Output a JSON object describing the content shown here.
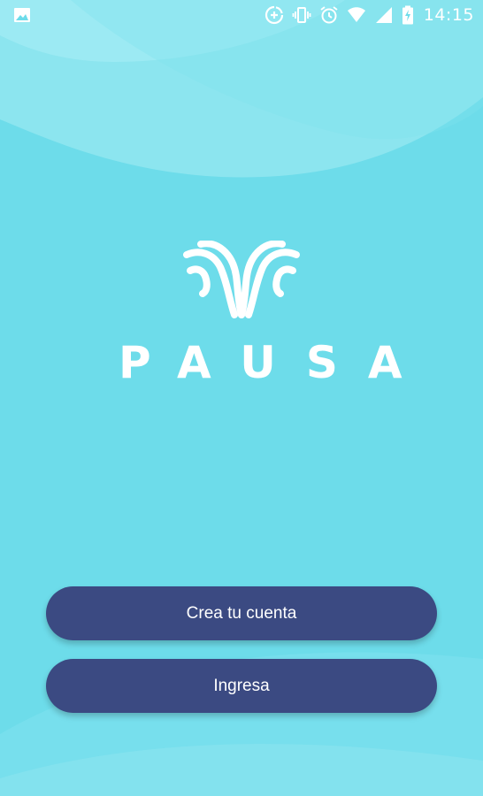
{
  "status_bar": {
    "time": "14:15",
    "left_icon": "image-notification-icon",
    "right_icons": [
      "data-saver-icon",
      "vibrate-icon",
      "alarm-icon",
      "wifi-icon",
      "signal-icon",
      "battery-charging-icon"
    ]
  },
  "brand": {
    "name": "PAUSA",
    "logo_icon": "butterfly-logo-icon"
  },
  "actions": {
    "create_account_label": "Crea tu cuenta",
    "login_label": "Ingresa"
  },
  "colors": {
    "background": "#6ddcea",
    "wave_light": "#9eeaf3",
    "button": "#3b4a82",
    "text": "#ffffff"
  }
}
